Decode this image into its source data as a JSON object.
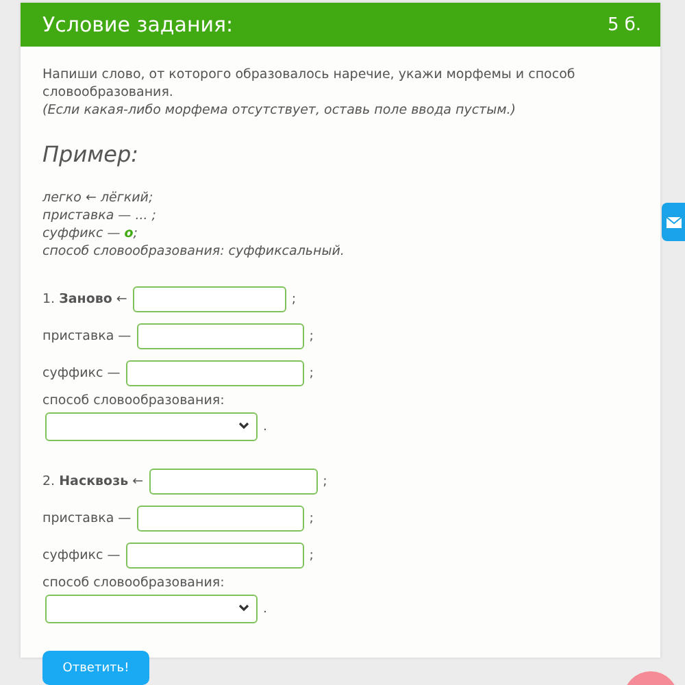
{
  "header": {
    "title": "Условие задания:",
    "points": "5 б."
  },
  "instructions": {
    "text": "Напиши слово, от которого образовалось наречие, укажи морфемы и способ словообразования.",
    "note": "(Если какая-либо морфема отсутствует, оставь поле ввода пустым.)"
  },
  "example": {
    "heading": "Пример:",
    "lines": [
      {
        "text": "легко ← лёгкий;"
      },
      {
        "text": "приставка — ... ;"
      },
      {
        "text": "суффикс — ",
        "highlight": "о",
        "after": ";"
      },
      {
        "text": "способ словообразования: суффиксальный."
      }
    ]
  },
  "tasks": [
    {
      "number": "1.",
      "word": "Заново",
      "arrow": "←",
      "end": ";",
      "fields": [
        {
          "label": "приставка —",
          "end": ";"
        },
        {
          "label": "суффикс —",
          "end": ";"
        }
      ],
      "method_label": "способ словообразования:",
      "method_end": "."
    },
    {
      "number": "2.",
      "word": "Насквозь",
      "arrow": "←",
      "end": ";",
      "fields": [
        {
          "label": "приставка —",
          "end": ";"
        },
        {
          "label": "суффикс —",
          "end": ";"
        }
      ],
      "method_label": "способ словообразования:",
      "method_end": "."
    }
  ],
  "submit": "Ответить!"
}
